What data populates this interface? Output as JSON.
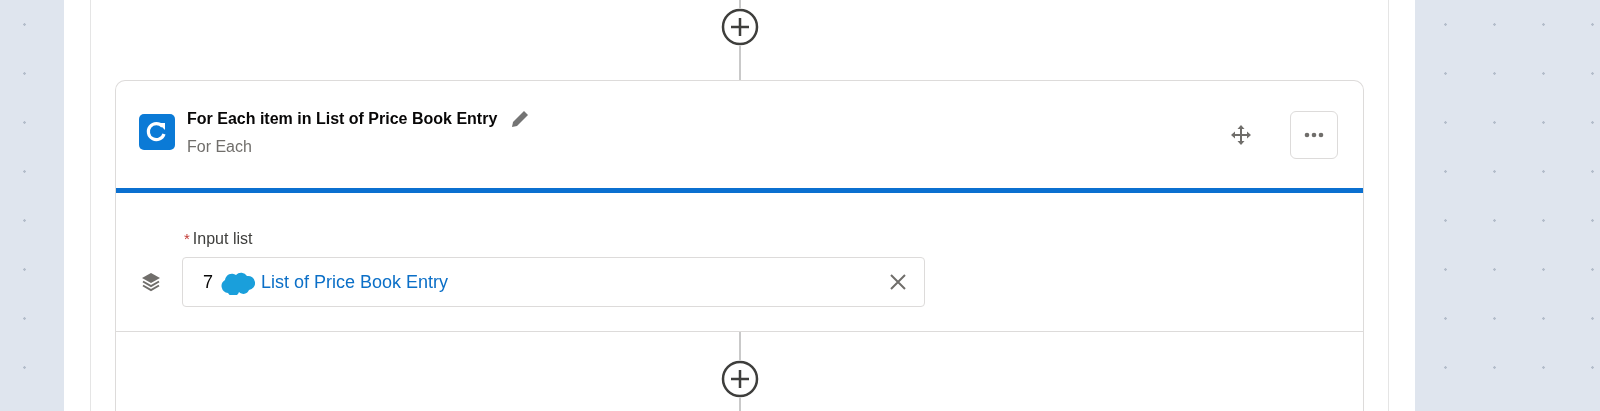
{
  "element": {
    "title": "For Each item in List of Price Book Entry",
    "subtitle": "For Each"
  },
  "input": {
    "label": "Input list",
    "required_mark": "*",
    "prefix": "7",
    "value": "List of Price Book Entry"
  }
}
